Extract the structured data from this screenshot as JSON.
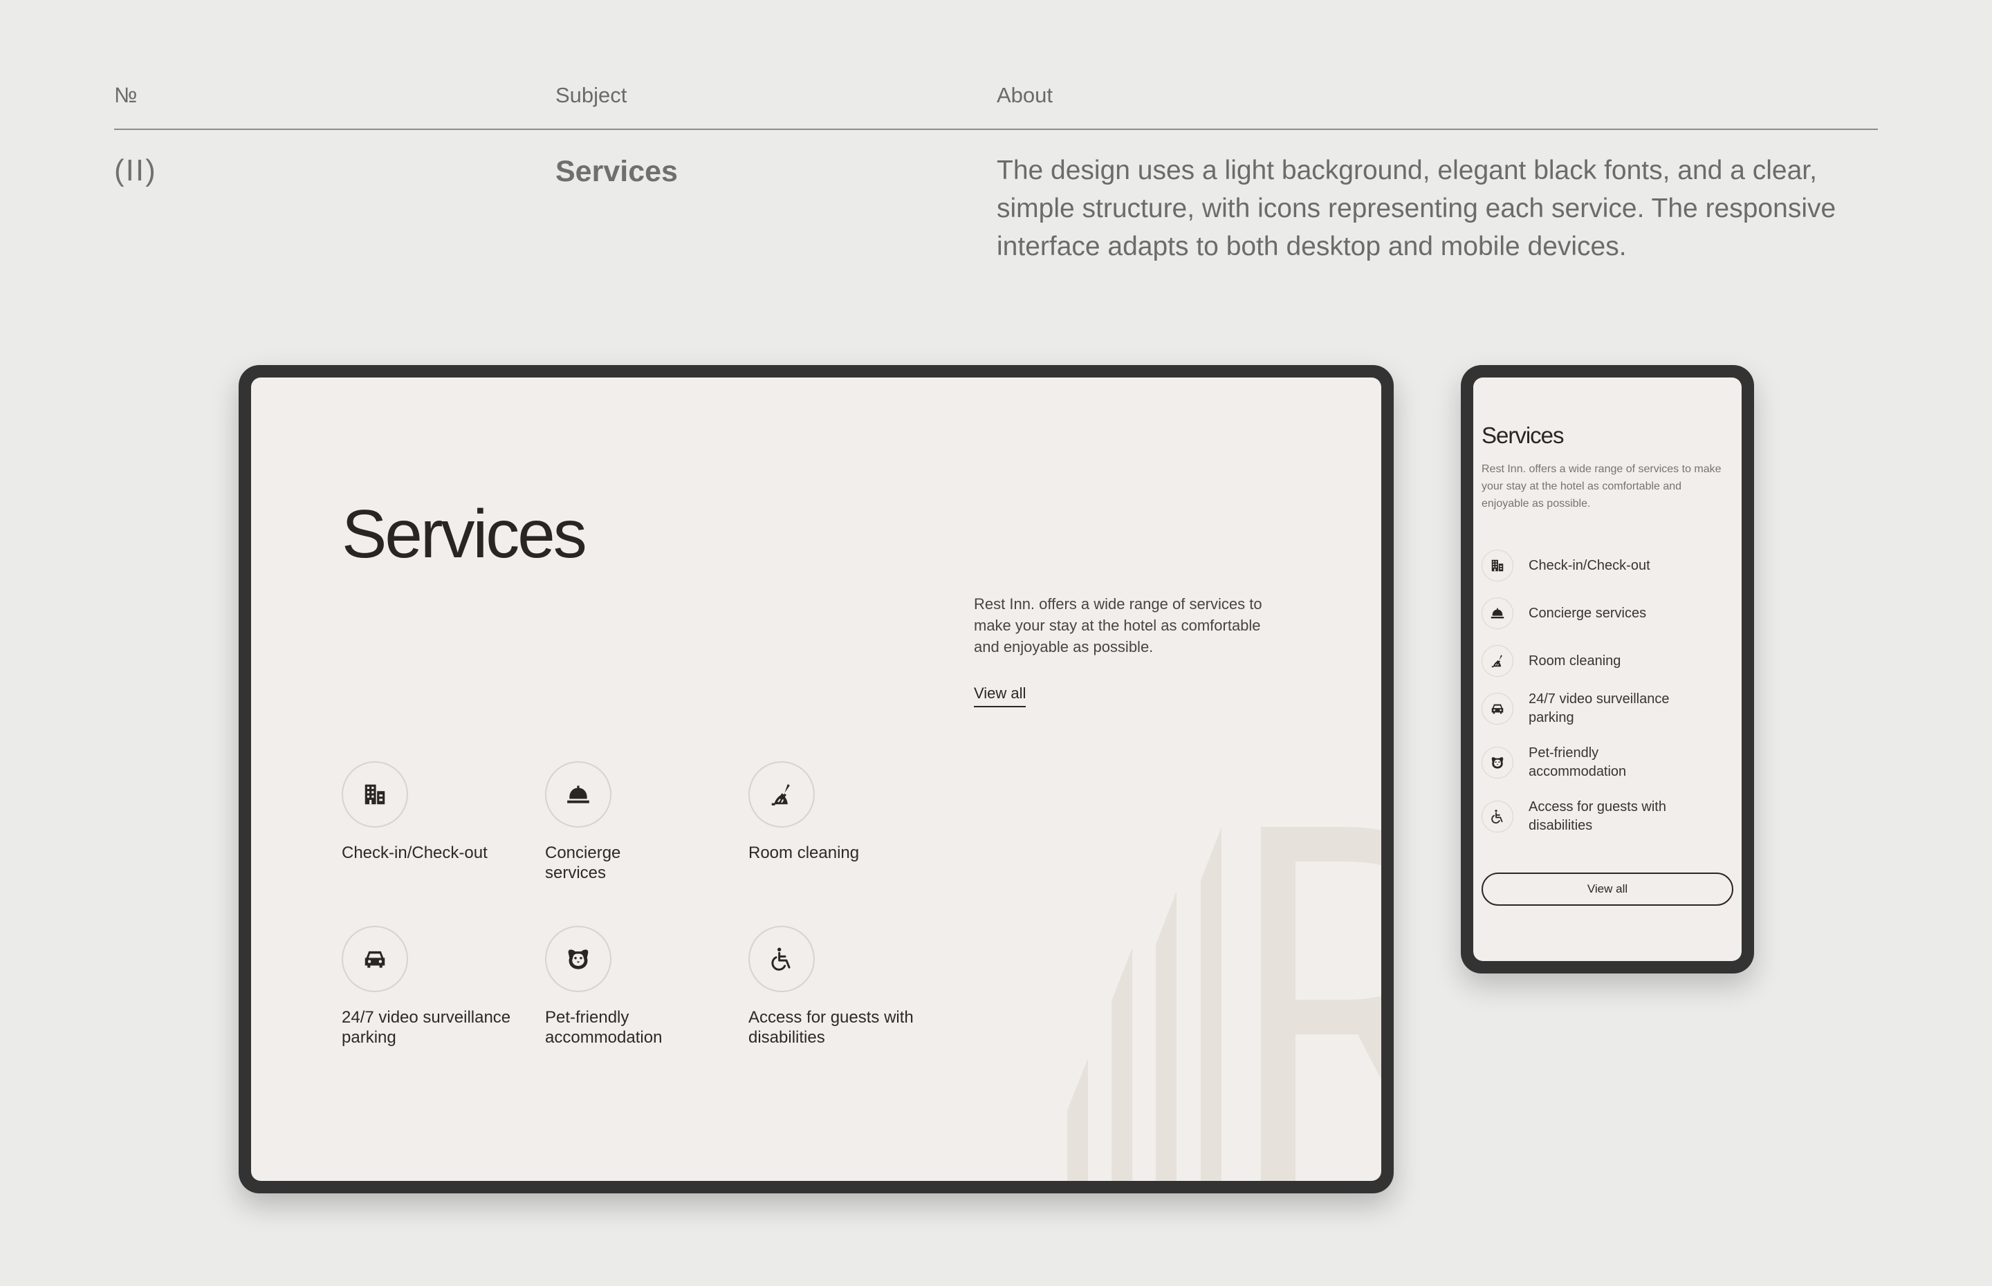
{
  "table": {
    "headers": {
      "no": "№",
      "subject": "Subject",
      "about": "About"
    },
    "row": {
      "no": "(II)",
      "subject": "Services",
      "about": "The design uses a light background, elegant black fonts, and a clear, simple structure, with icons representing each service. The responsive interface adapts to both desktop and mobile devices."
    }
  },
  "desktop": {
    "title": "Services",
    "description": "Rest Inn. offers a wide range of services to make your stay at the hotel as comfortable and enjoyable as possible.",
    "view_all": "View all",
    "services": [
      {
        "label": "Check-in/Check-out",
        "icon": "building-icon"
      },
      {
        "label": "Concierge services",
        "icon": "service-bell-icon"
      },
      {
        "label": "Room cleaning",
        "icon": "broom-icon"
      },
      {
        "label": "24/7 video surveillance parking",
        "icon": "car-icon"
      },
      {
        "label": "Pet-friendly accommodation",
        "icon": "dog-icon"
      },
      {
        "label": "Access for guests with disabilities",
        "icon": "wheelchair-icon"
      }
    ]
  },
  "mobile": {
    "title": "Services",
    "description": "Rest Inn. offers a wide range of services to make your stay at the hotel as comfortable and enjoyable as possible.",
    "view_all": "View all",
    "services": [
      {
        "label": "Check-in/Check-out",
        "icon": "building-icon"
      },
      {
        "label": "Concierge services",
        "icon": "service-bell-icon"
      },
      {
        "label": "Room cleaning",
        "icon": "broom-icon"
      },
      {
        "label": "24/7 video surveillance parking",
        "icon": "car-icon"
      },
      {
        "label": "Pet-friendly accommodation",
        "icon": "dog-icon"
      },
      {
        "label": "Access for guests with disabilities",
        "icon": "wheelchair-icon"
      }
    ]
  },
  "colors": {
    "page_background": "#ebebea",
    "device_frame": "#333333",
    "screen_background": "#f1eeeb",
    "text_dark": "#2a2522",
    "logo_watermark": "#e6e1da"
  }
}
